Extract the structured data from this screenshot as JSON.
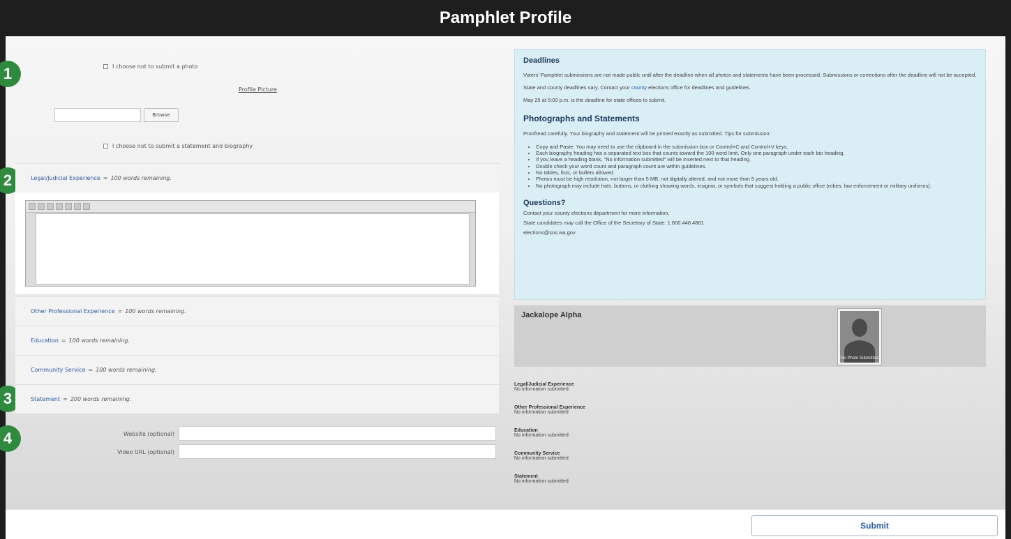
{
  "window": {
    "title": "Pamphlet Profile"
  },
  "markers": [
    "1",
    "2",
    "3",
    "4"
  ],
  "photo_section": {
    "no_photo_label": "I choose not to submit a photo",
    "profile_picture_link": "Profile Picture",
    "browse_label": "Browse",
    "no_statement_label": "I choose not to submit a statement and biography"
  },
  "sections": [
    {
      "title": "Legal/Judicial Experience",
      "remaining": "100 words remaining."
    },
    {
      "title": "Other Professional Experience",
      "remaining": "100 words remaining."
    },
    {
      "title": "Education",
      "remaining": "100 words remaining."
    },
    {
      "title": "Community Service",
      "remaining": "100 words remaining."
    },
    {
      "title": "Statement",
      "remaining": "200 words remaining."
    }
  ],
  "separator": "=",
  "fields": {
    "website_label": "Website (optional)",
    "video_label": "Video URL (optional)"
  },
  "info": {
    "deadlines_heading": "Deadlines",
    "deadlines_p1": "Voters' Pamphlet submissions are not made public until after the deadline when all photos and statements have been processed. Submissions or corrections after the deadline will not be accepted.",
    "deadlines_p2_pre": "State and county deadlines vary. Contact your",
    "deadlines_p2_link": "county",
    "deadlines_p2_post": "elections office for deadlines and guidelines.",
    "deadlines_p3": "May 25 at 5:00 p.m. is the deadline for state offices to submit.",
    "photos_heading": "Photographs and Statements",
    "photos_intro": "Proofread carefully. Your biography and statement will be printed exactly as submitted. Tips for submission:",
    "tips": [
      "Copy and Paste: You may need to use the clipboard in the submission box or Control+C and Control+V keys.",
      "Each biography heading has a separated text box that counts toward the 100 word limit. Only one paragraph under each bio heading.",
      "If you leave a heading blank, \"No information submitted\" will be inserted next to that heading.",
      "Double check your word count and paragraph count are within guidelines.",
      "No tables, lists, or bullets allowed.",
      "Photos must be high resolution, not larger than 5 MB, not digitally altered, and not more than 5 years old.",
      "No photograph may include hats, buttons, or clothing showing words, insignia, or symbols that suggest holding a public office (robes, law enforcement or military uniforms)."
    ],
    "questions_heading": "Questions?",
    "questions_p1": "Contact your county elections department for more information.",
    "questions_p2": "State candidates may call the Office of the Secretary of State: 1.800.448.4881",
    "questions_email": "elections@sos.wa.gov"
  },
  "preview": {
    "candidate_name": "Jackalope Alpha",
    "photo_caption": "No Photo Submitted"
  },
  "summary": [
    {
      "heading": "Legal/Judicial Experience",
      "value": "No information submitted"
    },
    {
      "heading": "Other Professional Experience",
      "value": "No information submitted"
    },
    {
      "heading": "Education",
      "value": "No information submitted"
    },
    {
      "heading": "Community Service",
      "value": "No information submitted"
    },
    {
      "heading": "Statement",
      "value": "No information submitted"
    }
  ],
  "footer": {
    "submit_label": "Submit"
  },
  "colors": {
    "accent": "#2a5db0",
    "marker": "#2e8b3e",
    "titlebar": "#1e1e1e",
    "info_bg": "#d9eef5"
  }
}
